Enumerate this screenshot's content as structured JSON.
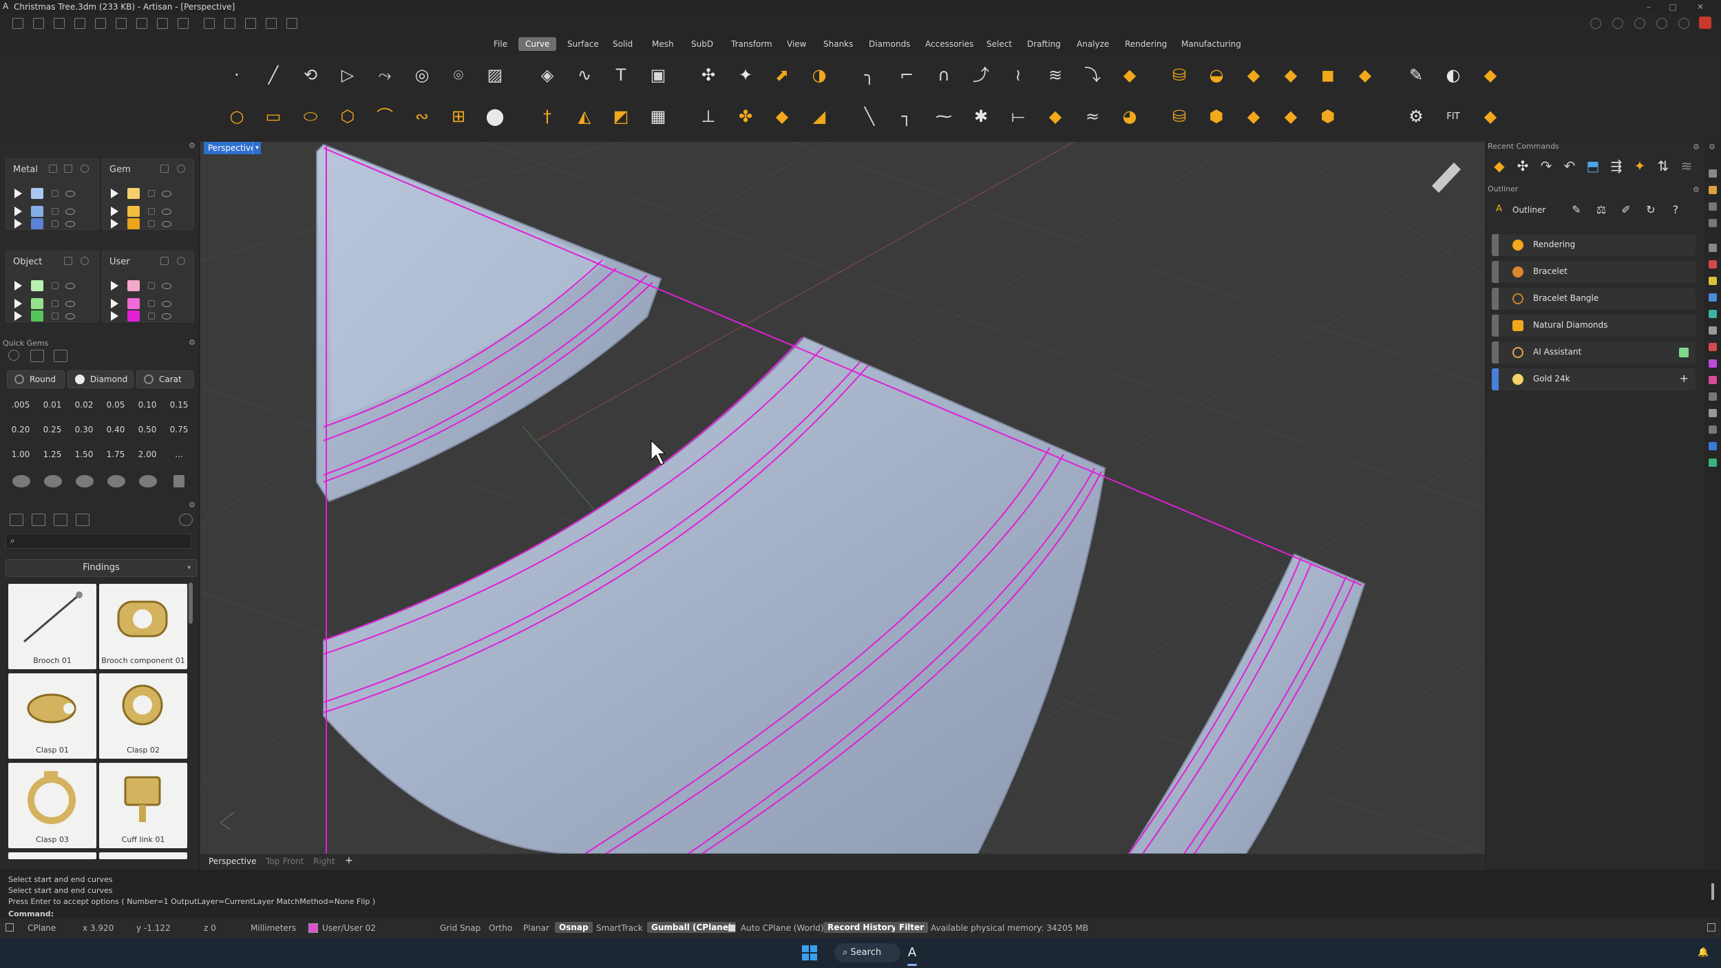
{
  "window": {
    "title": "Christmas Tree.3dm (233 KB) - Artisan - [Perspective]"
  },
  "menu": {
    "items": [
      "File",
      "Curve",
      "Surface",
      "Solid",
      "Mesh",
      "SubD",
      "Transform",
      "View",
      "Shanks",
      "Diamonds",
      "Accessories",
      "Select",
      "Drafting",
      "Analyze",
      "Rendering",
      "Manufacturing"
    ],
    "active": "Curve"
  },
  "layers": {
    "metal": {
      "title": "Metal",
      "swatches": [
        "#a9c9f2",
        "#86aee8",
        "#5b82d6"
      ]
    },
    "gem": {
      "title": "Gem",
      "swatches": [
        "#f5cf6a",
        "#f1bd3f",
        "#eda51b"
      ]
    },
    "object": {
      "title": "Object",
      "swatches": [
        "#b9f0b3",
        "#93e18a",
        "#55c45a"
      ]
    },
    "user": {
      "title": "User",
      "swatches": [
        "#f4a8c9",
        "#f06ad8",
        "#e020d6"
      ]
    }
  },
  "quick_gems": {
    "title": "Quick Gems",
    "shape_buttons": [
      "Round",
      "Diamond",
      "Carat"
    ],
    "sizes": [
      ".005",
      "0.01",
      "0.02",
      "0.05",
      "0.10",
      "0.15",
      "0.20",
      "0.25",
      "0.30",
      "0.40",
      "0.50",
      "0.75",
      "1.00",
      "1.25",
      "1.50",
      "1.75",
      "2.00",
      "..."
    ]
  },
  "library": {
    "category": "Findings",
    "items": [
      "Brooch 01",
      "Brooch component 01",
      "Clasp 01",
      "Clasp 02",
      "Clasp 03",
      "Cuff link 01"
    ]
  },
  "viewport": {
    "label": "Perspective",
    "tabs": [
      "Perspective",
      "Top",
      "Front",
      "Right"
    ],
    "add_tab": "+"
  },
  "right_panel": {
    "recent_commands_title": "Recent Commands",
    "outliner_section": "Outliner",
    "outliner_title": "Outliner",
    "items": [
      {
        "label": "Rendering",
        "color": "#f2a81c"
      },
      {
        "label": "Bracelet",
        "color": "#d9892e"
      },
      {
        "label": "Bracelet Bangle",
        "color": "#c8832f"
      },
      {
        "label": "Natural Diamonds",
        "color": "#f2a81c"
      },
      {
        "label": "AI Assistant",
        "color": "#e0a84a"
      },
      {
        "label": "Gold 24k",
        "color": "#f5d36c"
      }
    ]
  },
  "command": {
    "history": [
      "Select start and end curves",
      "Select start and end curves",
      "Press Enter to accept options ( Number=1  OutputLayer=CurrentLayer  MatchMethod=None  Flip )"
    ],
    "prompt": "Command:"
  },
  "status": {
    "cplane": "CPlane",
    "x": "x 3.920",
    "y": "y -1.122",
    "z": "z 0",
    "units": "Millimeters",
    "layer": "User/User 02",
    "layer_color": "#e050d0",
    "grid_snap": "Grid Snap",
    "ortho": "Ortho",
    "planar": "Planar",
    "osnap": "Osnap",
    "smarttrack": "SmartTrack",
    "gumball": "Gumball (CPlane)",
    "auto_cplane": "Auto CPlane (World)",
    "record_history": "Record History",
    "filter": "Filter",
    "memory": "Available physical memory: 34205 MB"
  },
  "taskbar": {
    "search": "Search"
  }
}
